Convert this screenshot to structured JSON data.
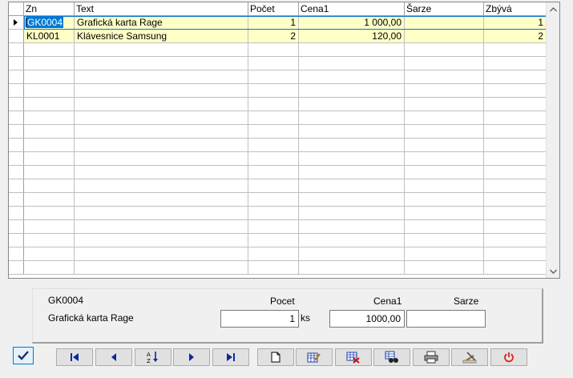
{
  "grid": {
    "columns": [
      "Zn",
      "Text",
      "Počet",
      "Cena1",
      "Šarze",
      "Zbývá"
    ],
    "rows": [
      {
        "zn": "GK0004",
        "text": "Grafická karta Rage",
        "pocet": "1",
        "cena1": "1 000,00",
        "sarze": "",
        "zbyva": "1"
      },
      {
        "zn": "KL0001",
        "text": "Klávesnice Samsung",
        "pocet": "2",
        "cena1": "120,00",
        "sarze": "",
        "zbyva": "2"
      }
    ]
  },
  "detail": {
    "code": "GK0004",
    "name": "Grafická karta Rage",
    "pocet_label": "Pocet",
    "pocet_value": "1",
    "unit": "ks",
    "cena_label": "Cena1",
    "cena_value": "1000,00",
    "sarze_label": "Sarze",
    "sarze_value": ""
  },
  "toolbar": {
    "buttons": [
      "confirm-icon",
      "first-record-icon",
      "previous-record-icon",
      "sort-az-icon",
      "next-record-icon",
      "last-record-icon",
      "new-document-icon",
      "edit-icon",
      "delete-icon",
      "search-binoculars-icon",
      "print-icon",
      "settings-icon",
      "power-icon"
    ]
  }
}
